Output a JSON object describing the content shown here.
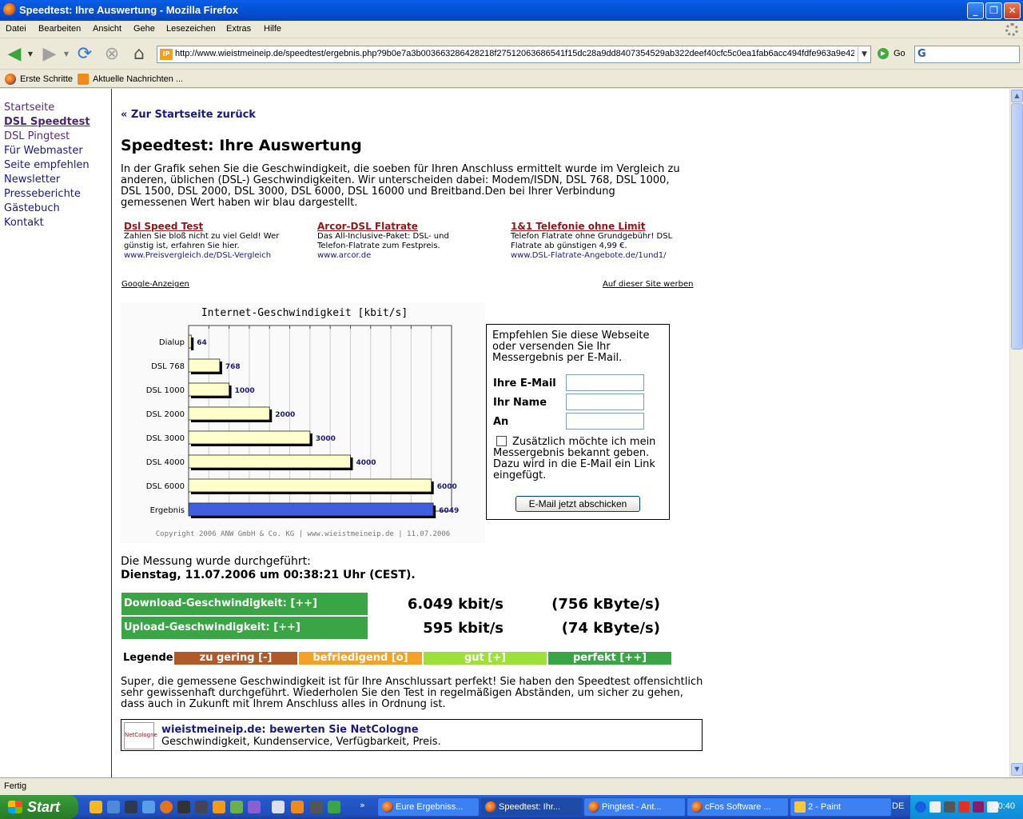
{
  "window": {
    "title": "Speedtest: Ihre Auswertung - Mozilla Firefox",
    "minimize": "_",
    "maximize": "❐",
    "close": "✕"
  },
  "menu": [
    "Datei",
    "Bearbeiten",
    "Ansicht",
    "Gehe",
    "Lesezeichen",
    "Extras",
    "Hilfe"
  ],
  "nav": {
    "url": "http://www.wieistmeineip.de/speedtest/ergebnis.php?9b0e7a3b003663286428218f27512063686541f15dc28a9dd8407354529ab322deef40cfc5c0ea1fab6acc494fdfe963a9e42",
    "favicon": "IP",
    "go_label": "Go",
    "search_glyph": "G"
  },
  "bookmarks": [
    "Erste Schritte",
    "Aktuelle Nachrichten ..."
  ],
  "sidebar": [
    {
      "label": "Startseite",
      "state": "visited"
    },
    {
      "label": "DSL Speedtest",
      "state": "active"
    },
    {
      "label": "DSL Pingtest",
      "state": "visited"
    },
    {
      "label": "Für Webmaster",
      "state": "normal"
    },
    {
      "label": "Seite empfehlen",
      "state": "normal"
    },
    {
      "label": "Newsletter",
      "state": "normal"
    },
    {
      "label": "Presseberichte",
      "state": "normal"
    },
    {
      "label": "Gästebuch",
      "state": "normal"
    },
    {
      "label": "Kontakt",
      "state": "normal"
    }
  ],
  "page": {
    "back_link": "« Zur Startseite zurück",
    "heading": "Speedtest: Ihre Auswertung",
    "intro": "In der Grafik sehen Sie die Geschwindigkeit, die soeben für Ihren Anschluss ermittelt wurde im Vergleich zu anderen, üblichen (DSL-) Geschwindigkeiten. Wir unterscheiden dabei: Modem/ISDN, DSL 768, DSL 1000, DSL 1500, DSL 2000, DSL 3000, DSL 6000, DSL 16000 und Breitband.Den bei Ihrer Verbindung gemessenen Wert haben wir blau dargestellt.",
    "ads": [
      {
        "title": "Dsl Speed Test",
        "body": "Zahlen Sie bloß nicht zu viel Geld! Wer günstig ist, erfahren Sie hier.",
        "url": "www.Preisvergleich.de/DSL-Vergleich"
      },
      {
        "title": "Arcor-DSL Flatrate",
        "body": "Das All-Inclusive-Paket: DSL- und Telefon-Flatrate zum Festpreis.",
        "url": "www.arcor.de"
      },
      {
        "title": "1&1 Telefonie ohne Limit",
        "body": "Telefon Flatrate ohne Grundgebühr! DSL Flatrate ab günstigen 4,99 €.",
        "url": "www.DSL-Flatrate-Angebote.de/1und1/"
      }
    ],
    "google_ads": "Google-Anzeigen",
    "advertise": "Auf dieser Site werben",
    "measured_label": "Die Messung wurde durchgeführt:",
    "measured_date": "Dienstag, 11.07.2006 um 00:38:21 Uhr (CEST).",
    "download_label": "Download-Geschwindigkeit: [++]",
    "download_kbit": "6.049 kbit/s",
    "download_kbyte": "(756 kByte/s)",
    "upload_label": "Upload-Geschwindigkeit: [++]",
    "upload_kbit": "595 kbit/s",
    "upload_kbyte": "(74 kByte/s)",
    "legend_label": "Legende:",
    "legend": [
      {
        "label": "zu gering [-]",
        "color": "#b05a2a"
      },
      {
        "label": "befriedigend [o]",
        "color": "#f3a227"
      },
      {
        "label": "gut [+]",
        "color": "#9de03a"
      },
      {
        "label": "perfekt [++]",
        "color": "#3aa545"
      }
    ],
    "summary": "Super, die gemessene Geschwindigkeit ist für Ihre Anschlussart perfekt! Sie haben den Speedtest offensichtlich sehr gewissenhaft durchgeführt. Wiederholen Sie den Test in regelmäßigen Abständen, um sicher zu gehen, dass auch in Zukunft mit Ihrem Anschluss alles in Ordnung ist.",
    "rating_title": "wieistmeineip.de: bewerten Sie NetCologne",
    "rating_sub": "Geschwindigkeit, Kundenservice, Verfügbarkeit, Preis.",
    "rating_logo": "NetCologne"
  },
  "form": {
    "intro": "Empfehlen Sie diese Webseite oder versenden Sie Ihr Messergebnis per E-Mail.",
    "email_label": "Ihre E-Mail",
    "name_label": "Ihr Name",
    "to_label": "An",
    "email_value": "",
    "name_value": "",
    "to_value": "",
    "checkbox_checked": false,
    "checkbox_text": "Zusätzlich möchte ich mein Messergebnis bekannt geben. Dazu wird in die E-Mail ein Link eingefügt.",
    "submit": "E-Mail jetzt abschicken"
  },
  "chart_data": {
    "type": "bar",
    "title": "Internet-Geschwindigkeit [kbit/s]",
    "categories": [
      "Dialup",
      "DSL 768",
      "DSL 1000",
      "DSL 2000",
      "DSL 3000",
      "DSL 4000",
      "DSL 6000",
      "Ergebnis"
    ],
    "values": [
      64,
      768,
      1000,
      2000,
      3000,
      4000,
      6000,
      6049
    ],
    "highlight": "Ergebnis",
    "bar_color": "#ffffcc",
    "highlight_color": "#3f5fe0",
    "xlim": [
      0,
      6500
    ],
    "grid": true,
    "copyright": "Copyright 2006 ANW GmbH & Co. KG | www.wieistmeineip.de | 11.07.2006"
  },
  "status": "Fertig",
  "taskbar": {
    "start": "Start",
    "tasks": [
      "Eure Ergebniss...",
      "Speedtest: Ihr...",
      "Pingtest - Ant...",
      "cFos Software ...",
      "2 - Paint"
    ],
    "lang": "DE",
    "clock": "00:40"
  }
}
